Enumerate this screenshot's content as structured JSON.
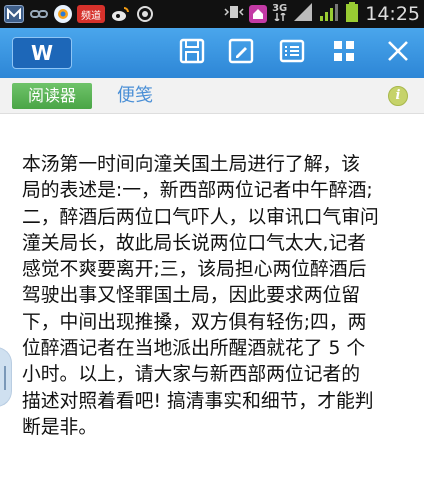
{
  "status_bar": {
    "time": "14:25",
    "network": "3G",
    "icons": [
      "m-app-icon",
      "link-icon",
      "news-app-icon",
      "weibo-icon",
      "browser-icon",
      "vibrate-icon",
      "home-icon",
      "signal-icon",
      "battery-icon"
    ],
    "app_badge": "频道"
  },
  "toolbar": {
    "logo_letter": "W",
    "buttons": [
      "save-icon",
      "edit-icon",
      "list-icon",
      "grid-icon",
      "close-icon"
    ]
  },
  "tabs": {
    "reader_label": "阅读器",
    "note_label": "便笺",
    "info_label": "i"
  },
  "article": {
    "text": "本汤第一时间向潼关国土局进行了解，该\n局的表述是:一，新西部两位记者中午醉酒;\n二，醉酒后两位口气吓人，以审讯口气审问\n潼关局长，故此局长说两位口气太大,记者\n感觉不爽要离开;三，该局担心两位醉酒后\n驾驶出事又怪罪国土局，因此要求两位留\n下，中间出现推搡，双方俱有轻伤;四，两\n位醉酒记者在当地派出所醒酒就花了 5 个\n小时。以上，请大家与新西部两位记者的\n描述对照着看吧! 搞清事实和细节，才能判\n断是非。"
  },
  "colors": {
    "toolbar": "#3a97e2",
    "reader_tab": "#5bb556",
    "note_text": "#4a8fd6"
  }
}
